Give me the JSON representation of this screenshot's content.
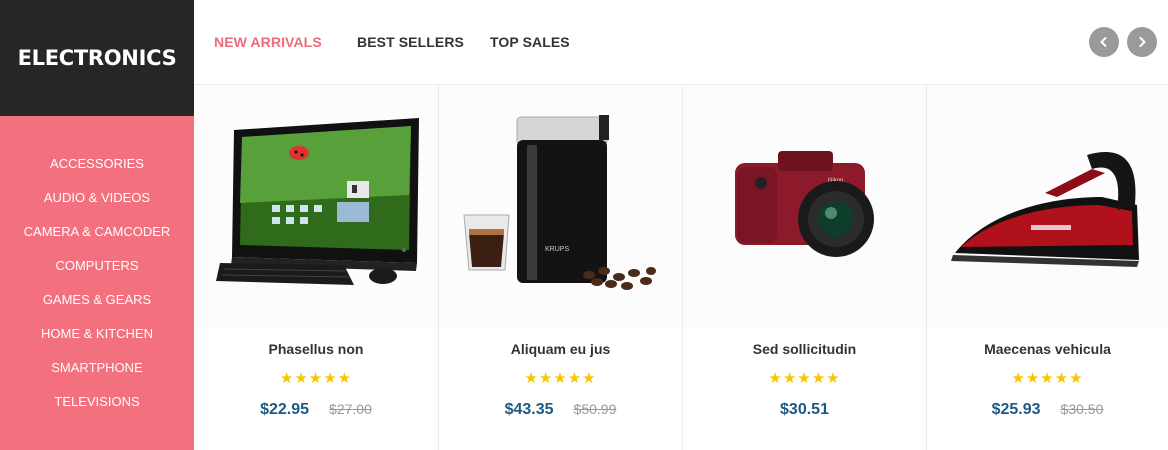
{
  "brand": {
    "name": "ELECTRONICS"
  },
  "categories": [
    "ACCESSORIES",
    "AUDIO & VIDEOS",
    "CAMERA & CAMCODER",
    "COMPUTERS",
    "GAMES & GEARS",
    "HOME & KITCHEN",
    "SMARTPHONE",
    "TELEVISIONS"
  ],
  "tabs": [
    {
      "label": "NEW ARRIVALS",
      "active": true
    },
    {
      "label": "BEST SELLERS",
      "active": false
    },
    {
      "label": "TOP SALES",
      "active": false
    }
  ],
  "products": [
    {
      "name": "Phasellus non",
      "price": "$22.95",
      "old_price": "$27.00",
      "rating": 5,
      "stars": "★★★★★",
      "image": "all-in-one-pc"
    },
    {
      "name": "Aliquam eu jus",
      "price": "$43.35",
      "old_price": "$50.99",
      "rating": 5,
      "stars": "★★★★★",
      "image": "coffee-grinder"
    },
    {
      "name": "Sed sollicitudin",
      "price": "$30.51",
      "old_price": "",
      "rating": 5,
      "stars": "★★★★★",
      "image": "dslr-camera"
    },
    {
      "name": "Maecenas vehicula",
      "price": "$25.93",
      "old_price": "$30.50",
      "rating": 5,
      "stars": "★★★★★",
      "image": "steam-iron"
    }
  ],
  "colors": {
    "accent": "#f3707e",
    "price": "#1c5a85",
    "star": "#f7c600",
    "brand_bg": "#262626"
  },
  "icons": {
    "prev": "chevron-left-icon",
    "next": "chevron-right-icon"
  }
}
